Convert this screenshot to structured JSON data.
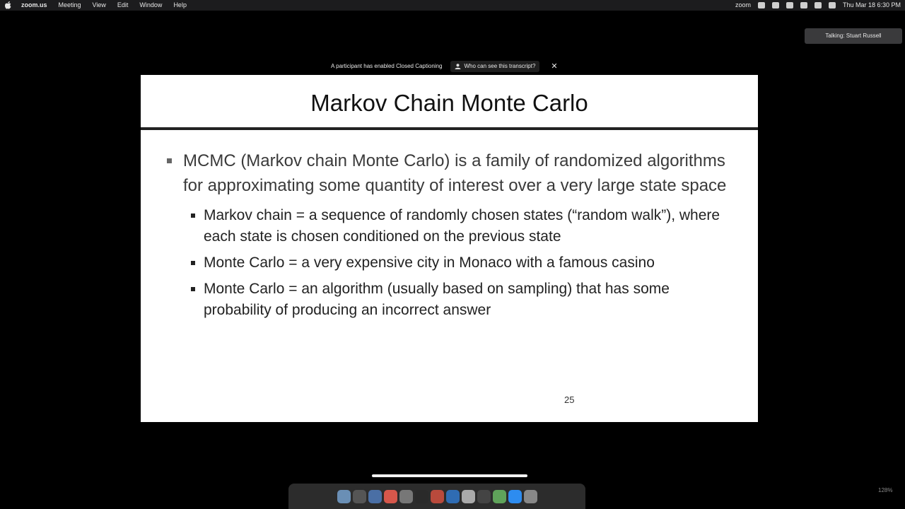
{
  "menubar": {
    "app_name": "zoom.us",
    "menus": [
      "Meeting",
      "View",
      "Edit",
      "Window",
      "Help"
    ],
    "right_app": "zoom",
    "clock": "Thu Mar 18  6:30 PM"
  },
  "talking": {
    "text": "Talking: Stuart Russell"
  },
  "caption_notice": {
    "message": "A participant has enabled Closed Captioning",
    "who_label": "Who can see this transcript?",
    "close_label": "✕"
  },
  "slide": {
    "title": "Markov Chain Monte Carlo",
    "main_bullet": "MCMC (Markov chain Monte Carlo) is a family of randomized algorithms for approximating some quantity of interest over a very large state space",
    "sub_bullets": [
      "Markov chain = a sequence of randomly chosen states (“random walk”), where each state is chosen conditioned on the previous state",
      "Monte Carlo = a very expensive city in Monaco with a famous casino",
      "Monte Carlo = an algorithm (usually based on sampling) that has some probability of producing an incorrect answer"
    ],
    "page_number": "25"
  },
  "bottom_bar": {
    "zoom_level": "128%"
  },
  "colors": {
    "background": "#000000",
    "slide_bg": "#ffffff",
    "menubar_bg": "#1c1c1e",
    "rule": "#222222"
  }
}
